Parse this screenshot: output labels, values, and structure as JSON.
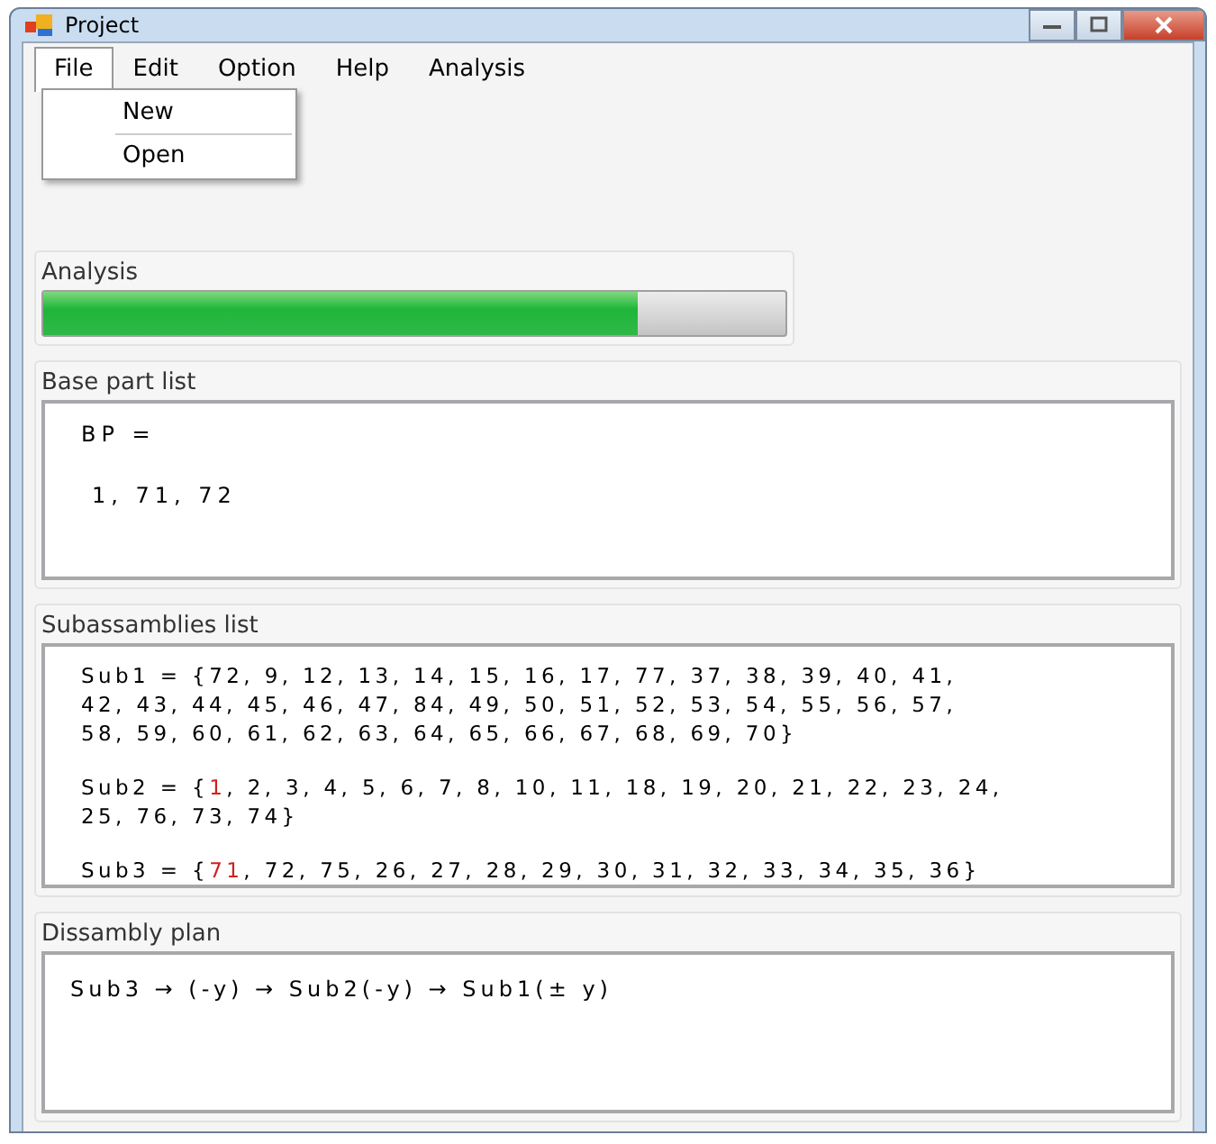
{
  "window": {
    "title": "Project"
  },
  "menu": [
    {
      "label": "File",
      "selected": true
    },
    {
      "label": "Edit",
      "selected": false
    },
    {
      "label": "Option",
      "selected": false
    },
    {
      "label": "Help",
      "selected": false
    },
    {
      "label": "Analysis",
      "selected": false
    }
  ],
  "file_menu": [
    "New",
    "Open"
  ],
  "analysis": {
    "title": "Analysis",
    "level": 0.8
  },
  "base_part_list": {
    "title": "Base part list",
    "lines": [
      "BP =",
      "1, 71, 72"
    ]
  },
  "subassemblies_list": {
    "title": "Subassamblies list",
    "items": [
      {
        "lines": [
          [
            {
              "text": "Sub1 = {72, 9, 12, 13, 14, 15, 16, 17, 77, 37, 38, 39, 40, 41,",
              "highlighted": false
            }
          ],
          [
            {
              "text": "42, 43, 44, 45, 46, 47, 84, 49, 50, 51, 52, 53, 54, 55, 56, 57,",
              "highlighted": false
            }
          ],
          [
            {
              "text": "58, 59, 60, 61, 62, 63, 64, 65, 66, 67, 68, 69, 70}",
              "highlighted": false
            }
          ]
        ]
      },
      {
        "lines": [
          [
            {
              "text": "Sub2 = {",
              "highlighted": false
            },
            {
              "text": "1",
              "highlighted": true
            },
            {
              "text": ", 2, 3, 4, 5, 6, 7, 8, 10, 11, 18, 19, 20, 21, 22, 23, 24,",
              "highlighted": false
            }
          ],
          [
            {
              "text": "25, 76, 73, 74}",
              "highlighted": false
            }
          ]
        ]
      },
      {
        "lines": [
          [
            {
              "text": "Sub3 = {",
              "highlighted": false
            },
            {
              "text": "71",
              "highlighted": true
            },
            {
              "text": ", 72, 75, 26, 27, 28, 29, 30, 31, 32, 33, 34, 35, 36}",
              "highlighted": false
            }
          ]
        ]
      }
    ]
  },
  "dissambly_plan": {
    "title": "Dissambly plan",
    "text": "Sub3 → (-y) → Sub2(-y) → Sub1(± y)"
  }
}
